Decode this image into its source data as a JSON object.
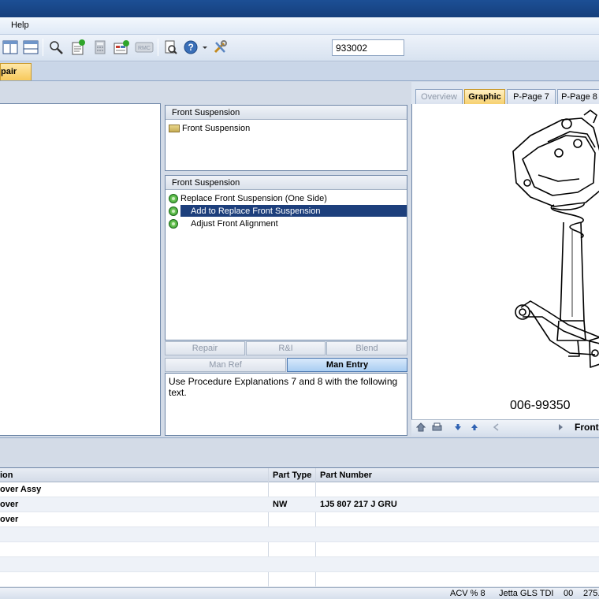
{
  "menu": {
    "help": "Help"
  },
  "toolbar": {
    "search_value": "933002",
    "colors": {
      "accent": "#1d3f7c",
      "tab_active": "#f7c95a"
    }
  },
  "main_tabs": [
    {
      "label": "pair"
    }
  ],
  "category_pane": {
    "header": "Front Suspension",
    "items": [
      {
        "label": "Front Suspension",
        "icon": "folder-icon"
      }
    ]
  },
  "procedure_pane": {
    "header": "Front Suspension",
    "items": [
      {
        "label": "Replace Front Suspension (One Side)",
        "icon": "procedure-icon",
        "selected": false
      },
      {
        "label": "Add to Replace Front Suspension",
        "icon": "procedure-icon",
        "selected": true
      },
      {
        "label": "Adjust Front Alignment",
        "icon": "procedure-icon",
        "selected": false
      }
    ]
  },
  "op_buttons": {
    "repair": "Repair",
    "ri": "R&I",
    "blend": "Blend",
    "man_ref": "Man Ref",
    "man_entry": "Man Entry"
  },
  "note_text": "Use Procedure Explanations 7 and 8 with the following text.",
  "graphic_tabs": [
    {
      "label": "Overview",
      "state": "disabled"
    },
    {
      "label": "Graphic",
      "state": "active"
    },
    {
      "label": "P-Page 7",
      "state": "normal"
    },
    {
      "label": "P-Page 8",
      "state": "normal"
    }
  ],
  "graphic": {
    "part_number": "006-99350",
    "nav_label": "Front"
  },
  "parts_table": {
    "columns": [
      "ion",
      "Part Type",
      "Part Number"
    ],
    "rows": [
      {
        "desc": "over Assy",
        "type": "",
        "number": ""
      },
      {
        "desc": "over",
        "type": "NW",
        "number": "1J5 807 217 J  GRU"
      },
      {
        "desc": "over",
        "type": "",
        "number": ""
      },
      {
        "desc": "",
        "type": "",
        "number": ""
      },
      {
        "desc": "",
        "type": "",
        "number": ""
      },
      {
        "desc": "",
        "type": "",
        "number": ""
      },
      {
        "desc": "",
        "type": "",
        "number": ""
      }
    ]
  },
  "status": {
    "acv": "ACV % 8",
    "vehicle": "Jetta GLS TDI",
    "code": "00",
    "amount": "275."
  }
}
